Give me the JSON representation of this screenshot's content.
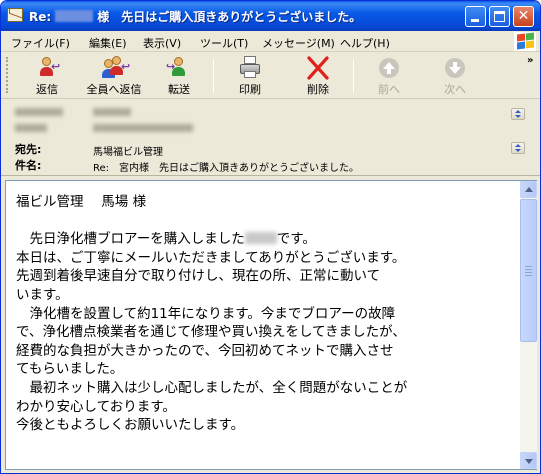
{
  "window": {
    "title_prefix": "Re:",
    "title_suffix": "様　先日はご購入頂きありがとうございました。"
  },
  "menu": {
    "items": [
      "ファイル(F)",
      "編集(E)",
      "表示(V)",
      "ツール(T)",
      "メッセージ(M)",
      "ヘルプ(H)"
    ]
  },
  "toolbar": {
    "reply": "返信",
    "reply_all": "全員へ返信",
    "forward": "転送",
    "print": "印刷",
    "delete": "削除",
    "previous": "前へ",
    "next": "次へ",
    "overflow": "»"
  },
  "headers": {
    "to_label": "宛先:",
    "to_value": "馬場福ビル管理",
    "subject_label": "件名:",
    "subject_value": "Re:　宮内様　先日はご購入頂きありがとうございました。"
  },
  "body": {
    "lines": [
      "福ビル管理　 馬場  様",
      "",
      "　先日浄化槽ブロアーを購入しました",
      "本日は、ご丁寧にメールいただきましてありがとうございます。",
      "先週到着後早速自分で取り付けし、現在の所、正常に動いて",
      "います。",
      "　浄化槽を設置して約11年になります。今までブロアーの故障",
      "で、浄化槽点検業者を通じて修理や買い換えをしてきましたが、",
      "経費的な負担が大きかったので、今回初めてネットで購入させ",
      "てもらいました。",
      "　最初ネット購入は少し心配しましたが、全く問題がないことが",
      "わかり安心しております。",
      "今後ともよろしくお願いいたします。"
    ],
    "line3_tail": "です。"
  },
  "colors": {
    "titlebar": "#0859e6",
    "close_button": "#c6421c",
    "delete_icon": "#e0201a",
    "chrome": "#ece9d8"
  }
}
